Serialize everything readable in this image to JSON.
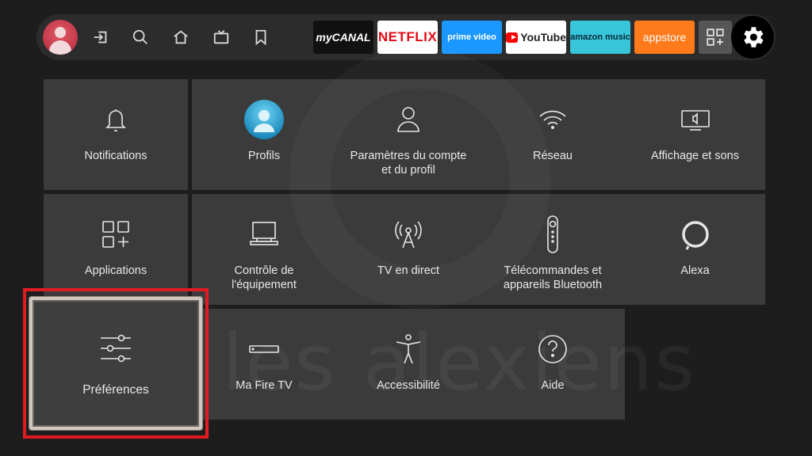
{
  "nav": {
    "icons": [
      "avatar",
      "input-icon",
      "search-icon",
      "home-icon",
      "live-tv-icon",
      "bookmark-icon"
    ],
    "apps": [
      {
        "name": "myCANAL",
        "bg": "#111111",
        "fg": "#ffffff"
      },
      {
        "name": "NETFLIX",
        "bg": "#ffffff",
        "fg": "#e50914"
      },
      {
        "name": "prime video",
        "bg": "#1a98ff",
        "fg": "#ffffff"
      },
      {
        "name": "YouTube",
        "bg": "#ffffff",
        "fg": "#222222"
      },
      {
        "name": "amazon music",
        "bg": "#36c5d9",
        "fg": "#0b2a3a"
      },
      {
        "name": "appstore",
        "bg": "#ff7a1a",
        "fg": "#ffffff"
      }
    ],
    "accent": "#e01b22"
  },
  "tiles": [
    {
      "id": "notifications",
      "label": "Notifications",
      "icon": "bell-icon"
    },
    {
      "id": "profiles",
      "label": "Profils",
      "icon": "profile-avatar-icon"
    },
    {
      "id": "account",
      "label": "Paramètres du compte\net du profil",
      "icon": "person-icon"
    },
    {
      "id": "network",
      "label": "Réseau",
      "icon": "wifi-icon"
    },
    {
      "id": "display",
      "label": "Affichage et sons",
      "icon": "tv-sound-icon"
    },
    {
      "id": "applications",
      "label": "Applications",
      "icon": "apps-grid-icon"
    },
    {
      "id": "device",
      "label": "Contrôle de\nl'équipement",
      "icon": "monitor-icon"
    },
    {
      "id": "live-tv",
      "label": "TV en direct",
      "icon": "antenna-icon"
    },
    {
      "id": "remotes",
      "label": "Télécommandes et\nappareils Bluetooth",
      "icon": "remote-icon"
    },
    {
      "id": "alexa",
      "label": "Alexa",
      "icon": "alexa-ring-icon"
    },
    {
      "id": "preferences",
      "label": "Préférences",
      "icon": "sliders-icon"
    },
    {
      "id": "my-fire-tv",
      "label": "Ma Fire TV",
      "icon": "fire-tv-box-icon"
    },
    {
      "id": "accessibility",
      "label": "Accessibilité",
      "icon": "accessibility-icon"
    },
    {
      "id": "help",
      "label": "Aide",
      "icon": "help-icon"
    }
  ],
  "watermark": "les alexiens"
}
